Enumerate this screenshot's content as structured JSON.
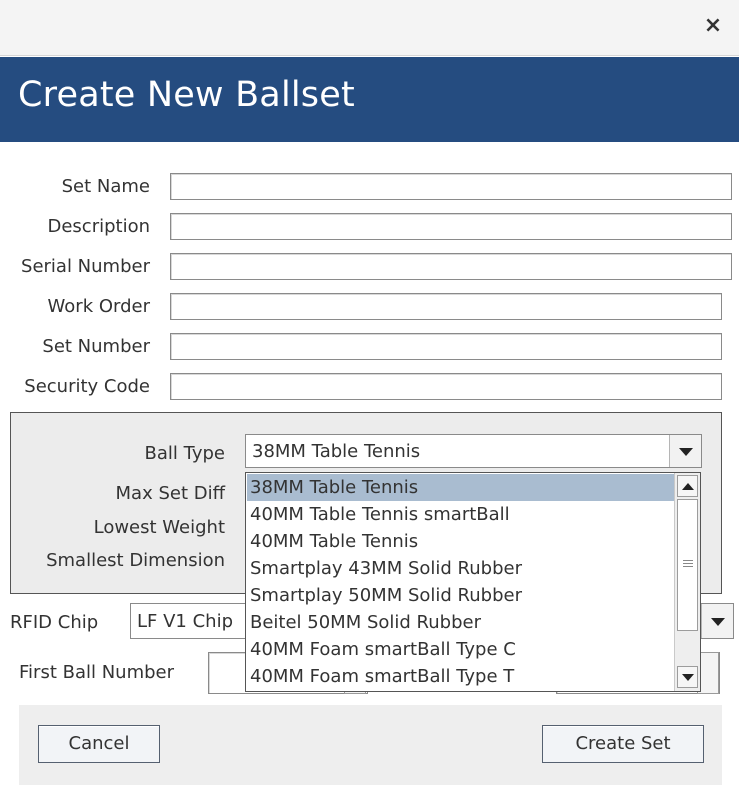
{
  "window": {
    "close_glyph": "×"
  },
  "header": {
    "title": "Create New Ballset"
  },
  "form": {
    "set_name_label": "Set Name",
    "description_label": "Description",
    "serial_number_label": "Serial Number",
    "work_order_label": "Work Order",
    "set_number_label": "Set Number",
    "security_code_label": "Security Code"
  },
  "panel": {
    "ball_type_label": "Ball Type",
    "ball_type_value": "38MM Table Tennis",
    "max_set_diff_label": "Max Set Diff",
    "lowest_weight_label": "Lowest Weight",
    "smallest_dimension_label": "Smallest Dimension"
  },
  "dropdown": {
    "options": [
      "38MM Table Tennis",
      "40MM Table Tennis smartBall",
      "40MM Table Tennis",
      "Smartplay 43MM Solid Rubber",
      "Smartplay 50MM Solid Rubber",
      "Beitel 50MM Solid Rubber",
      "40MM Foam smartBall Type C",
      "40MM Foam smartBall Type T"
    ],
    "selected_index": 0
  },
  "rfid": {
    "label": "RFID Chip",
    "value": "LF V1 Chip"
  },
  "first_ball": {
    "label": "First Ball Number"
  },
  "buttons": {
    "cancel": "Cancel",
    "create": "Create Set"
  },
  "colors": {
    "header_bg": "#254c80",
    "selected_option_bg": "#a9bcd0"
  },
  "icons": {
    "close": "close-icon",
    "dropdown_arrow": "chevron-down-icon",
    "scroll_up": "arrow-up-icon",
    "scroll_down": "arrow-down-icon"
  }
}
